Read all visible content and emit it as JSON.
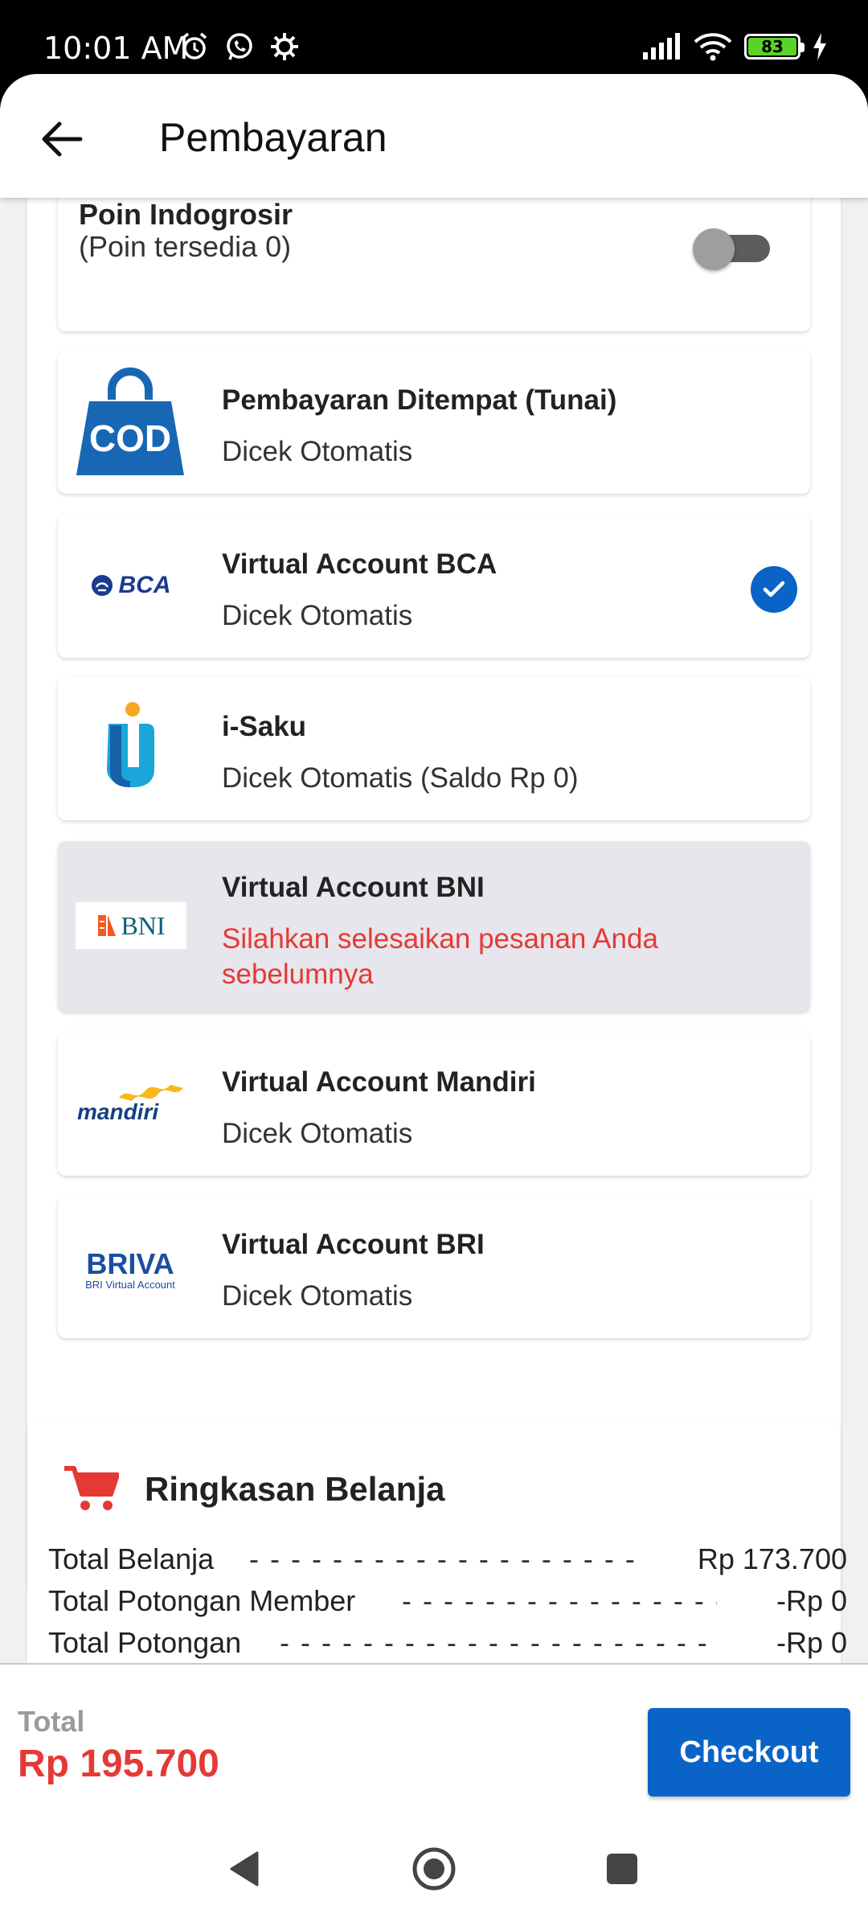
{
  "status_bar": {
    "time": "10:01 AM",
    "battery": "83",
    "icons": [
      "alarm-icon",
      "whatsapp-icon",
      "settings-icon",
      "signal-icon",
      "wifi-icon",
      "battery-icon",
      "charging-icon"
    ]
  },
  "header": {
    "title": "Pembayaran",
    "back_icon": "arrow-left-icon"
  },
  "poin": {
    "title": "Poin Indogrosir",
    "subtitle": "(Poin tersedia 0)",
    "toggle_on": false
  },
  "payment_methods": [
    {
      "logo": "COD",
      "name": "Pembayaran Ditempat (Tunai)",
      "desc": "Dicek Otomatis",
      "selected": false,
      "disabled": false
    },
    {
      "logo": "BCA",
      "name": "Virtual Account BCA",
      "desc": "Dicek Otomatis",
      "selected": true,
      "disabled": false
    },
    {
      "logo": "i-Saku",
      "name": "i-Saku",
      "desc": "Dicek Otomatis (Saldo Rp 0)",
      "selected": false,
      "disabled": false
    },
    {
      "logo": "BNI",
      "name": "Virtual Account BNI",
      "desc": "Silahkan selesaikan pesanan Anda sebelumnya",
      "selected": false,
      "disabled": true
    },
    {
      "logo": "mandiri",
      "name": "Virtual Account Mandiri",
      "desc": "Dicek Otomatis",
      "selected": false,
      "disabled": false
    },
    {
      "logo": "BRIVA",
      "logo_sub": "BRI Virtual Account",
      "name": "Virtual Account BRI",
      "desc": "Dicek Otomatis",
      "selected": false,
      "disabled": false
    }
  ],
  "summary": {
    "title": "Ringkasan Belanja",
    "rows": [
      {
        "label": "Total Belanja",
        "value": "Rp 173.700"
      },
      {
        "label": "Total Potongan Member",
        "value": "-Rp 0"
      },
      {
        "label": "Total Potongan",
        "value": "-Rp 0"
      }
    ]
  },
  "footer": {
    "total_label": "Total",
    "total_value": "Rp 195.700",
    "checkout_label": "Checkout"
  },
  "colors": {
    "primary": "#0a64c8",
    "error": "#e53935",
    "disabled_bg": "#e6e6ec"
  }
}
